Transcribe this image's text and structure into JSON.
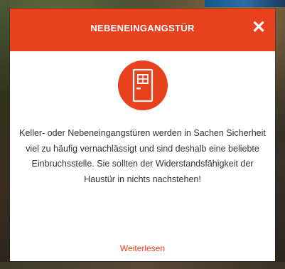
{
  "modal": {
    "title": "NEBENEINGANGSTÜR",
    "close_symbol": "✕",
    "icon": "door-icon",
    "description": "Keller- oder Nebeneingangstüren werden in Sachen Sicherheit viel zu häufig vernachlässigt und sind deshalb eine beliebte Einbruchsstelle. Sie sollten der Widerstandsfähigkeit der Haustür in nichts nachstehen!",
    "read_more_label": "Weiterlesen"
  },
  "colors": {
    "accent": "#e8411e",
    "text": "#333333",
    "background": "#ffffff"
  }
}
